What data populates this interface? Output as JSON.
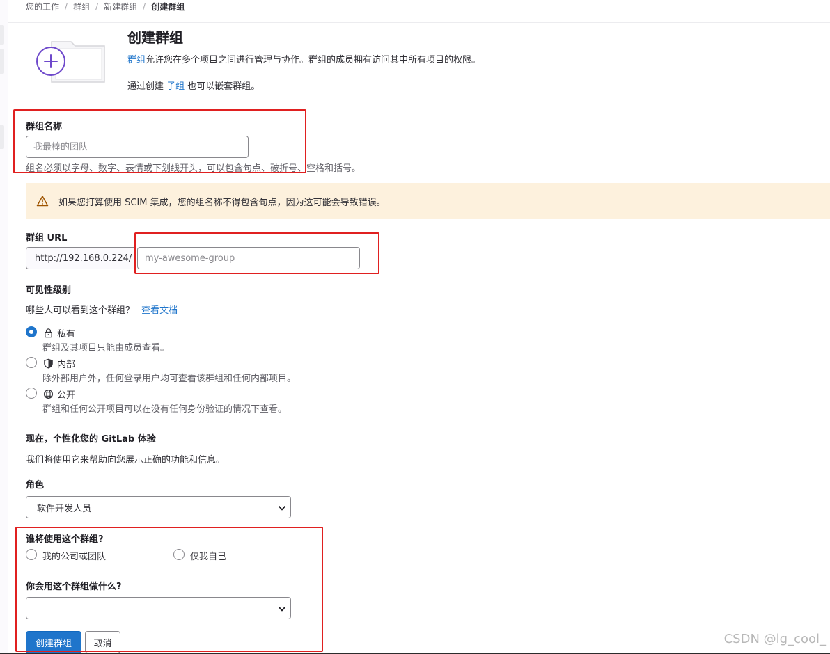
{
  "breadcrumb": [
    "您的工作",
    "群组",
    "新建群组",
    "创建群组"
  ],
  "header": {
    "title": "创建群组",
    "intro_link": "群组",
    "intro_text": "允许您在多个项目之间进行管理与协作。群组的成员拥有访问其中所有项目的权限。",
    "subgroup_prefix": "通过创建 ",
    "subgroup_link": "子组",
    "subgroup_suffix": " 也可以嵌套群组。"
  },
  "group_name": {
    "label": "群组名称",
    "placeholder": "我最棒的团队",
    "value": "",
    "help": "组名必须以字母、数字、表情或下划线开头，可以包含句点、破折号、空格和括号。"
  },
  "alert": {
    "icon": "warning-icon",
    "text": "如果您打算使用 SCIM 集成，您的组名称不得包含句点，因为这可能会导致错误。"
  },
  "group_url": {
    "label": "群组 URL",
    "prefix": "http://192.168.0.224/",
    "placeholder": "my-awesome-group",
    "value": ""
  },
  "visibility": {
    "label": "可见性级别",
    "question": "哪些人可以看到这个群组？",
    "docs_link": "查看文档",
    "options": [
      {
        "label": "私有",
        "icon": "lock-icon",
        "help": "群组及其项目只能由成员查看。",
        "checked": true
      },
      {
        "label": "内部",
        "icon": "shield-icon",
        "help": "除外部用户外，任何登录用户均可查看该群组和任何内部项目。",
        "checked": false
      },
      {
        "label": "公开",
        "icon": "globe-icon",
        "help": "群组和任何公开项目可以在没有任何身份验证的情况下查看。",
        "checked": false
      }
    ]
  },
  "personalize": {
    "title": "现在，个性化您的 GitLab 体验",
    "subtitle": "我们将使用它来帮助向您展示正确的功能和信息。"
  },
  "role": {
    "label": "角色",
    "selected": "软件开发人员"
  },
  "audience": {
    "label": "谁将使用这个群组?",
    "options": [
      "我的公司或团队",
      "仅我自己"
    ]
  },
  "purpose": {
    "label": "你会用这个群组做什么?",
    "selected": ""
  },
  "actions": {
    "create": "创建群组",
    "cancel": "取消"
  },
  "watermark": "CSDN @lg_cool_",
  "colors": {
    "accent": "#1f75cb",
    "alert_bg": "#fdf1dd",
    "annotation_red": "#e02020",
    "illustration_purple": "#6e49cb"
  }
}
